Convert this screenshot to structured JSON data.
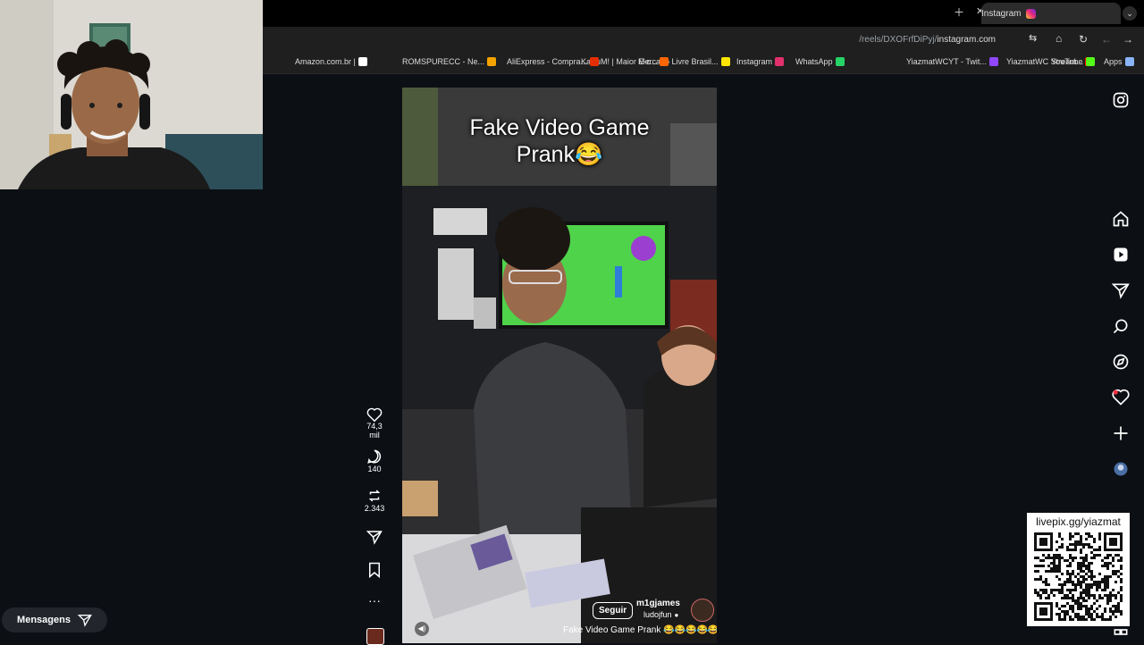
{
  "browser": {
    "tab_title": "Instagram",
    "url_host": "instagram.com",
    "url_path": "/reels/DXOFrfDiPyj/",
    "bookmarks": [
      {
        "label": "Apps",
        "color": "#8ab4f8"
      },
      {
        "label": "YouTube",
        "color": "#ff0000"
      },
      {
        "label": "YiazmatWC Stream...",
        "color": "#53fc18"
      },
      {
        "label": "YiazmatWCYT - Twit...",
        "color": "#9146ff"
      },
      {
        "label": "WhatsApp",
        "color": "#25d366"
      },
      {
        "label": "Instagram",
        "color": "#e1306c"
      },
      {
        "label": "Mercado Livre Brasil...",
        "color": "#ffe600"
      },
      {
        "label": "KaBuM! | Maior E-c...",
        "color": "#ff6500"
      },
      {
        "label": "AliExpress - Compra...",
        "color": "#e62e04"
      },
      {
        "label": "ROMSPURECC - Ne...",
        "color": "#f4a300"
      },
      {
        "label": "Amazon.com.br |",
        "color": "#ffffff"
      }
    ]
  },
  "reel": {
    "caption_line1": "Fake Video Game",
    "caption_line2": "Prank😂",
    "username": "m1gjames",
    "audio": "ludojfun",
    "follow_label": "Seguir",
    "description": "Fake Video Game Prank 😂😂😂😂😂",
    "likes": "74,3 mil",
    "comments": "140",
    "reposts": "2.343"
  },
  "messages_label": "Mensagens",
  "qr_label": "livepix.gg/yiazmat",
  "colors": {
    "instagram_accent": "#e1306c",
    "page_bg": "#0c0f14"
  },
  "icons": [
    "home-icon",
    "reels-icon",
    "send-icon",
    "search-icon",
    "explore-icon",
    "heart-icon",
    "create-icon",
    "profile-icon",
    "instagram-logo-icon"
  ]
}
